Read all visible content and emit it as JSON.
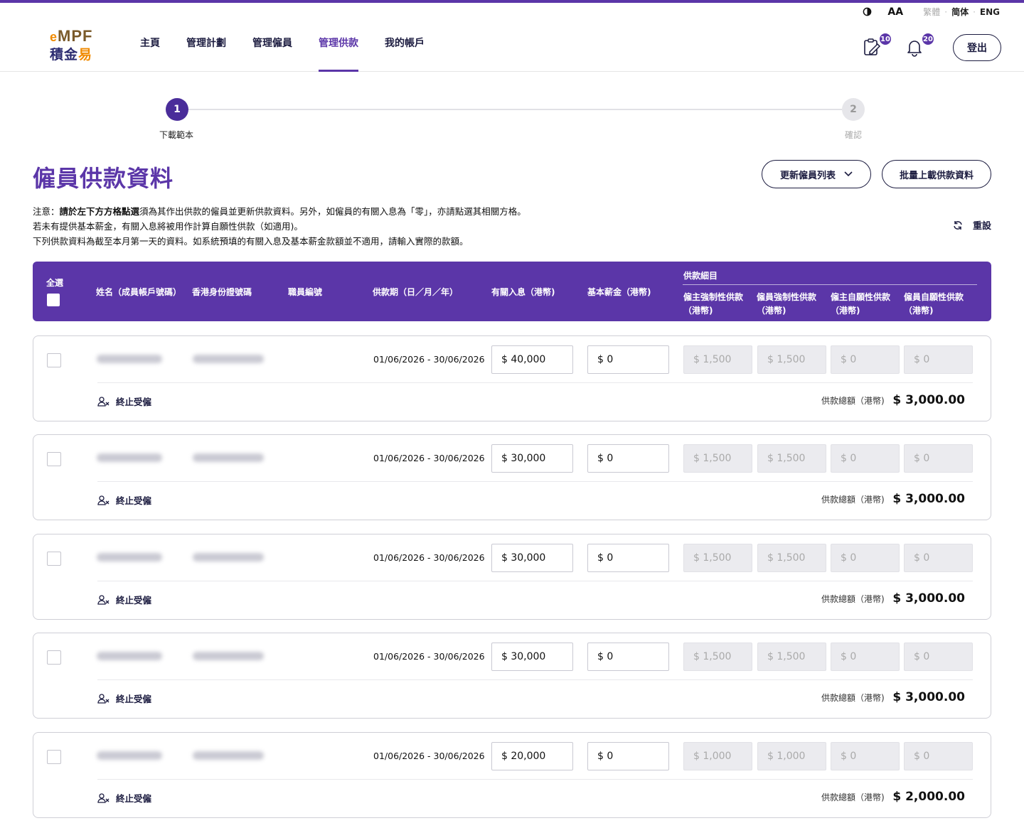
{
  "utility": {
    "contrast_icon": "contrast-icon",
    "font_size_label": "AA",
    "lang_trad": "繁體",
    "lang_simp": "简体",
    "lang_eng": "ENG"
  },
  "header": {
    "logo_text": "MPF",
    "logo_zh": "積金",
    "logo_zh_accent": "易",
    "nav": [
      "主頁",
      "管理計劃",
      "管理僱員",
      "管理供款",
      "我的帳戶"
    ],
    "active_nav": "管理供款",
    "task_badge": "10",
    "notification_badge": "20",
    "logout_label": "登出"
  },
  "stepper": {
    "steps": [
      {
        "number": "1",
        "label": "下載範本",
        "state": "active"
      },
      {
        "number": "2",
        "label": "確認",
        "state": "inactive"
      }
    ]
  },
  "page": {
    "title": "僱員供款資料",
    "update_button": "更新僱員列表",
    "bulk_button": "批量上載供款資料",
    "note_prefix": "注意：",
    "note_bold": "請於左下方方格點選",
    "note_line1_rest": "須為其作出供款的僱員並更新供款資料。另外，如僱員的有關入息為「零」，亦請點選其相關方格。",
    "note_line2": "若未有提供基本薪金，有關入息將被用作計算自願性供款（如適用)。",
    "note_line3": "下列供款資料為截至本月第一天的資料。如系統預填的有關入息及基本薪金款額並不適用，請輸入實際的款額。",
    "reset_label": "重設"
  },
  "table": {
    "select_all": "全選",
    "col_name": "姓名（成員帳戶號碼）",
    "col_hkid": "香港身份證號碼",
    "col_staff_no": "職員編號",
    "col_period": "供款期（日／月／年）",
    "col_income": "有關入息（港幣)",
    "col_salary": "基本薪金（港幣)",
    "group_title": "供款細目",
    "sub_er_mc": "僱主強制性供款",
    "sub_ee_mc": "僱員強制性供款",
    "sub_er_vc": "僱主自願性供款",
    "sub_ee_vc": "僱員自願性供款",
    "sub_unit": "（港幣)",
    "terminate_label": "終止受僱",
    "total_label": "供款總額（港幣)"
  },
  "rows": [
    {
      "period": "01/06/2026 - 30/06/2026",
      "income": "$ 40,000",
      "salary": "$ 0",
      "er_mc": "$ 1,500",
      "ee_mc": "$ 1,500",
      "er_vc": "$ 0",
      "ee_vc": "$ 0",
      "total": "$ 3,000.00"
    },
    {
      "period": "01/06/2026 - 30/06/2026",
      "income": "$ 30,000",
      "salary": "$ 0",
      "er_mc": "$ 1,500",
      "ee_mc": "$ 1,500",
      "er_vc": "$ 0",
      "ee_vc": "$ 0",
      "total": "$ 3,000.00"
    },
    {
      "period": "01/06/2026 - 30/06/2026",
      "income": "$ 30,000",
      "salary": "$ 0",
      "er_mc": "$ 1,500",
      "ee_mc": "$ 1,500",
      "er_vc": "$ 0",
      "ee_vc": "$ 0",
      "total": "$ 3,000.00"
    },
    {
      "period": "01/06/2026 - 30/06/2026",
      "income": "$ 30,000",
      "salary": "$ 0",
      "er_mc": "$ 1,500",
      "ee_mc": "$ 1,500",
      "er_vc": "$ 0",
      "ee_vc": "$ 0",
      "total": "$ 3,000.00"
    },
    {
      "period": "01/06/2026 - 30/06/2026",
      "income": "$ 20,000",
      "salary": "$ 0",
      "er_mc": "$ 1,000",
      "ee_mc": "$ 1,000",
      "er_vc": "$ 0",
      "ee_vc": "$ 0",
      "total": "$ 2,000.00"
    }
  ],
  "colors": {
    "brand_purple": "#5b36a8",
    "navy": "#1c1c40",
    "logo_orange": "#f08a00"
  }
}
